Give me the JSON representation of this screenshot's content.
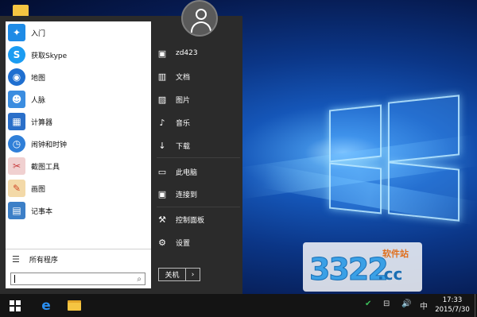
{
  "start_menu": {
    "apps": [
      {
        "label": "入门",
        "icon": "lightbulb-icon",
        "color": "#1e8be6",
        "glyph": "💡"
      },
      {
        "label": "获取Skype",
        "icon": "skype-icon",
        "color": "#1b9cf2",
        "glyph": "S"
      },
      {
        "label": "地图",
        "icon": "map-pin-icon",
        "color": "#1f6fd0",
        "glyph": "◉"
      },
      {
        "label": "人脉",
        "icon": "people-icon",
        "color": "#3b8de0",
        "glyph": "👥"
      },
      {
        "label": "计算器",
        "icon": "calculator-icon",
        "color": "#2a6fc9",
        "glyph": "▦"
      },
      {
        "label": "闹钟和时钟",
        "icon": "alarm-clock-icon",
        "color": "#2f7fd8",
        "glyph": "⏰"
      },
      {
        "label": "截图工具",
        "icon": "scissors-icon",
        "color": "#c83c3c",
        "glyph": "✂"
      },
      {
        "label": "画图",
        "icon": "paint-palette-icon",
        "color": "#d98a2b",
        "glyph": "🎨"
      },
      {
        "label": "记事本",
        "icon": "notepad-icon",
        "color": "#3c7fc7",
        "glyph": "▤"
      }
    ],
    "all_programs": "所有程序",
    "search_placeholder": ""
  },
  "places": [
    {
      "label": "zd423",
      "icon": "user-document-icon",
      "glyph": "▣"
    },
    {
      "label": "文档",
      "icon": "documents-icon",
      "glyph": "▥"
    },
    {
      "label": "图片",
      "icon": "pictures-icon",
      "glyph": "▨"
    },
    {
      "label": "音乐",
      "icon": "music-note-icon",
      "glyph": "♪"
    },
    {
      "label": "下载",
      "icon": "download-icon",
      "glyph": "↓"
    },
    {
      "label": "此电脑",
      "icon": "computer-icon",
      "glyph": "▭"
    },
    {
      "label": "连接到",
      "icon": "connect-icon",
      "glyph": "▣"
    },
    {
      "label": "控制面板",
      "icon": "wrench-icon",
      "glyph": "🔧"
    },
    {
      "label": "设置",
      "icon": "gear-icon",
      "glyph": "⚙"
    }
  ],
  "power": {
    "shutdown_label": "关机",
    "arrow": "›"
  },
  "watermark": {
    "digits": "3322",
    "cn_text": "软件站",
    "domain": ".cc"
  },
  "taskbar": {
    "time": "17:33",
    "date": "2015/7/30",
    "ime": "中",
    "volume": "🔊",
    "network": "⊟",
    "security": "✔"
  },
  "colors": {
    "menu_bg": "#2b2b2b",
    "apps_bg": "#ffffff",
    "taskbar_bg": "#141414"
  }
}
